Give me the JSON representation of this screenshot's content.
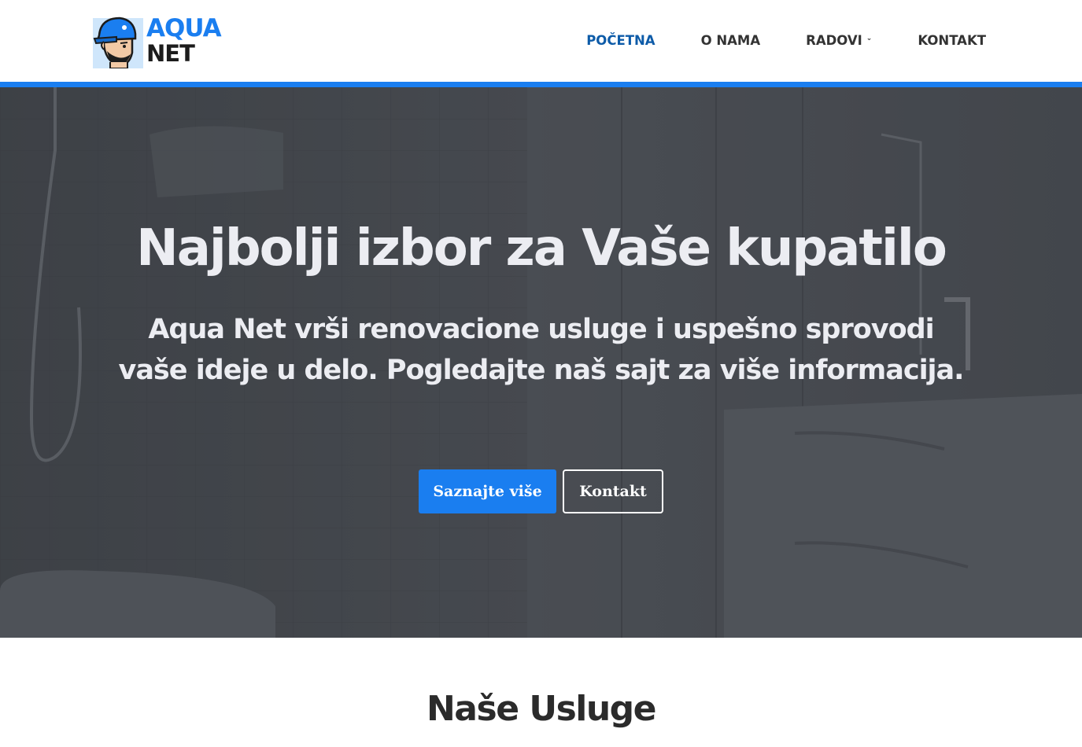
{
  "brand": {
    "line1": "AQUA",
    "line2": "NET",
    "accent_color": "#1a7ef0",
    "dark_color": "#1c1c1c"
  },
  "nav": {
    "items": [
      {
        "label": "POČETNA",
        "active": true
      },
      {
        "label": "O NAMA",
        "active": false
      },
      {
        "label": "RADOVI",
        "active": false,
        "has_dropdown": true,
        "icon": "chevron-down-icon"
      },
      {
        "label": "KONTAKT",
        "active": false
      }
    ],
    "active_color": "#0d5ba8"
  },
  "hero": {
    "title": "Najbolji izbor za Vaše kupatilo",
    "subtitle": "Aqua Net vrši renovacione usluge i uspešno sprovodi vaše ideje u delo. Pogledajte naš sajt za više informacija.",
    "primary_button": "Saznajte više",
    "secondary_button": "Kontakt"
  },
  "services": {
    "title": "Naše Usluge"
  }
}
